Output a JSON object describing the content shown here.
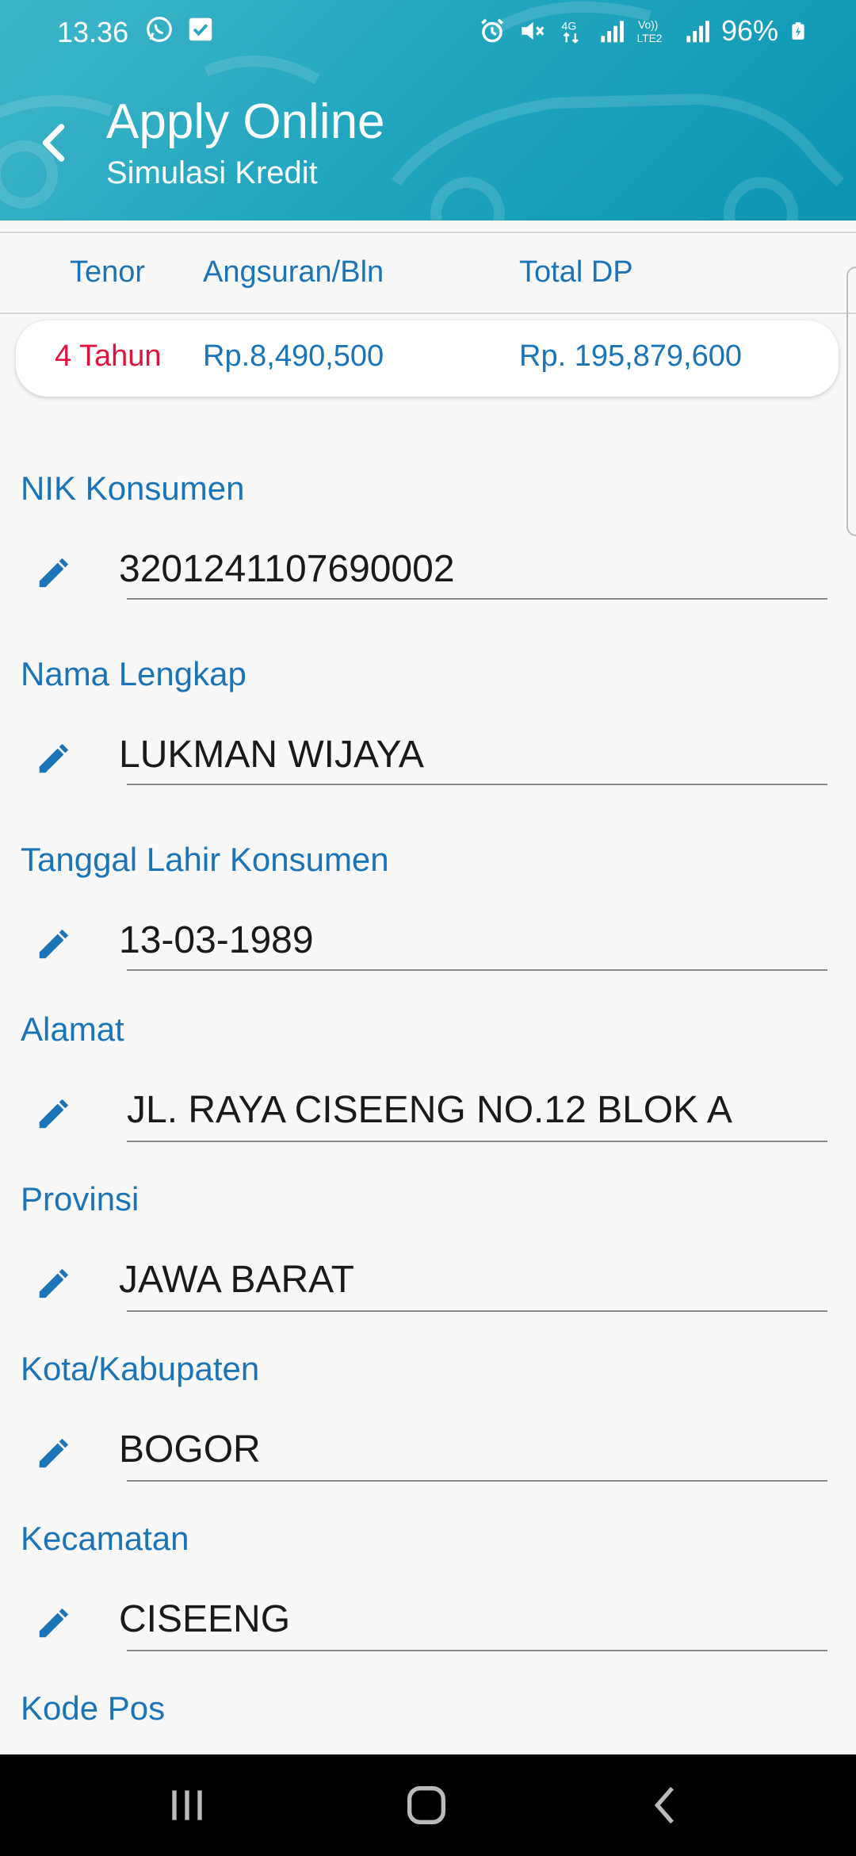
{
  "status_bar": {
    "time": "13.36",
    "left_icons": [
      "whatsapp-icon",
      "check-box-icon"
    ],
    "right_icons": [
      "alarm-icon",
      "mute-icon",
      "4g-icon",
      "signal-icon",
      "volte-lte2-icon",
      "signal2-icon"
    ],
    "battery": "96%"
  },
  "header": {
    "title": "Apply Online",
    "subtitle": "Simulasi Kredit"
  },
  "summary_table": {
    "headers": [
      "Tenor",
      "Angsuran/Bln",
      "Total DP"
    ],
    "row": {
      "tenor": "4 Tahun",
      "angsuran": "Rp.8,490,500",
      "total_dp": "Rp. 195,879,600"
    }
  },
  "fields": [
    {
      "label": "NIK Konsumen",
      "value": "3201241107690002"
    },
    {
      "label": "Nama Lengkap",
      "value": "LUKMAN WIJAYA"
    },
    {
      "label": "Tanggal Lahir Konsumen",
      "value": "13-03-1989"
    },
    {
      "label": "Alamat",
      "value": "JL. RAYA CISEENG NO.12 BLOK A"
    },
    {
      "label": "Provinsi",
      "value": "JAWA BARAT"
    },
    {
      "label": "Kota/Kabupaten",
      "value": "BOGOR"
    },
    {
      "label": "Kecamatan",
      "value": "CISEENG"
    },
    {
      "label": "Kode Pos",
      "value": ""
    }
  ],
  "colors": {
    "accent": "#1c74b8",
    "tenor": "#e0123e",
    "header_gradient_start": "#3fb6c9",
    "header_gradient_end": "#0b95b3"
  },
  "nav_bar": [
    "recents-icon",
    "home-icon",
    "back-icon"
  ]
}
